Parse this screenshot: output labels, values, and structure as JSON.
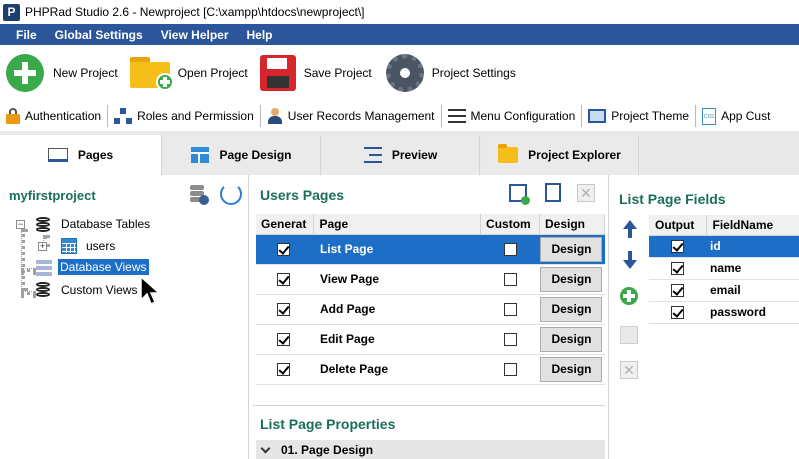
{
  "window": {
    "app_icon": "P",
    "title": "PHPRad Studio 2.6 - Newproject [C:\\xampp\\htdocs\\newproject\\]"
  },
  "menu": [
    "File",
    "Global Settings",
    "View Helper",
    "Help"
  ],
  "toolbar": {
    "new_project": "New Project",
    "open_project": "Open Project",
    "save_project": "Save Project",
    "project_settings": "Project Settings"
  },
  "toolbar2": {
    "authentication": "Authentication",
    "roles": "Roles and Permission",
    "user_records": "User Records Management",
    "menu_config": "Menu Configuration",
    "project_theme": "Project Theme",
    "app_custom": "App Cust"
  },
  "tabs": {
    "pages": "Pages",
    "page_design": "Page Design",
    "preview": "Preview",
    "project_explorer": "Project Explorer"
  },
  "left": {
    "project_name": "myfirstproject",
    "db_tables": "Database Tables",
    "users": "users",
    "db_views": "Database Views",
    "custom_views": "Custom Views"
  },
  "users_pages": {
    "title": "Users Pages",
    "columns": {
      "generate": "Generat",
      "page": "Page",
      "custom": "Custom",
      "design": "Design"
    },
    "rows": [
      {
        "page": "List Page",
        "generate": true,
        "custom": false,
        "design": "Design"
      },
      {
        "page": "View Page",
        "generate": true,
        "custom": false,
        "design": "Design"
      },
      {
        "page": "Add Page",
        "generate": true,
        "custom": false,
        "design": "Design"
      },
      {
        "page": "Edit Page",
        "generate": true,
        "custom": false,
        "design": "Design"
      },
      {
        "page": "Delete Page",
        "generate": true,
        "custom": false,
        "design": "Design"
      }
    ]
  },
  "list_page_props": {
    "title": "List Page Properties",
    "section": "01. Page Design"
  },
  "list_page_fields": {
    "title": "List Page Fields",
    "columns": {
      "output": "Output",
      "fieldname": "FieldName"
    },
    "rows": [
      {
        "field": "id",
        "output": true
      },
      {
        "field": "name",
        "output": true
      },
      {
        "field": "email",
        "output": true
      },
      {
        "field": "password",
        "output": true
      }
    ]
  },
  "colors": {
    "menubar": "#2b579a",
    "selection": "#1d6ec7",
    "panel_title": "#1a6e5c"
  }
}
